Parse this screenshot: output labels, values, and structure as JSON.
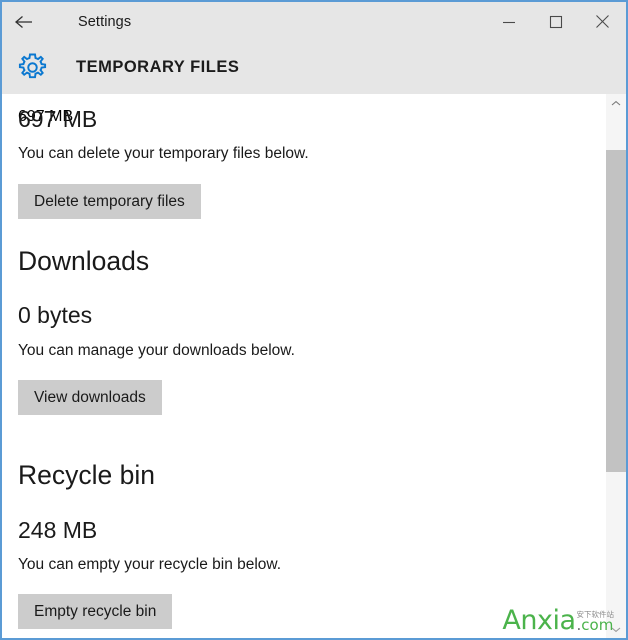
{
  "window": {
    "border_color": "#5b9bd5",
    "titlebar_bg": "#e6e6e6",
    "header_bg": "#e6e6e6",
    "content_bg": "#ffffff"
  },
  "titlebar": {
    "back_label": "back-arrow",
    "title": "Settings",
    "minimize": "minimize",
    "maximize": "maximize",
    "close": "close"
  },
  "header": {
    "icon": "gear-icon",
    "icon_color": "#0b78d0",
    "title": "TEMPORARY FILES"
  },
  "sections": [
    {
      "id": "temporary-files",
      "heading": null,
      "size": "697 MB",
      "description": "You can delete your temporary files below.",
      "button": "Delete temporary files"
    },
    {
      "id": "downloads",
      "heading": "Downloads",
      "size": "0 bytes",
      "description": "You can manage your downloads below.",
      "button": "View downloads"
    },
    {
      "id": "recycle-bin",
      "heading": "Recycle bin",
      "size": "248 MB",
      "description": "You can empty your recycle bin below.",
      "button": "Empty recycle bin"
    }
  ],
  "scrollbar": {
    "up_arrow": "chevron-up-icon",
    "down_arrow": "chevron-down-icon",
    "thumb_color": "#c2c2c2",
    "track_color": "#f5f5f5"
  },
  "watermark": {
    "brand": "Anxia",
    "cn_text": "安下软件站",
    "dot": ".",
    "tld": "com",
    "color": "#4bb34b"
  }
}
